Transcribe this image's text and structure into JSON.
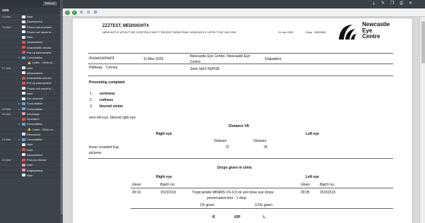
{
  "sidebar": {
    "refresh_label": "Refresh",
    "year": "2025",
    "events": [
      {
        "date": "11-Mar",
        "icon": "white",
        "label": "Note",
        "depth": 1
      },
      {
        "date": "",
        "icon": "doc",
        "label": "Assessment",
        "depth": 2
      },
      {
        "date": "10-Mar",
        "icon": "doc",
        "label": "Phone call received",
        "depth": 2
      },
      {
        "date": "",
        "icon": "doc",
        "label": "Phone call made to ...",
        "depth": 2
      },
      {
        "date": "",
        "icon": "doc",
        "label": "Note",
        "depth": 2
      },
      {
        "date": "",
        "icon": "red",
        "label": "Assessment",
        "depth": 2
      },
      {
        "date": "",
        "icon": "red",
        "label": "Anaesthetic checks",
        "depth": 2
      },
      {
        "date": "",
        "icon": "red",
        "label": "Pre-op assessment",
        "depth": 2
      },
      {
        "date": "",
        "icon": "blue",
        "label": "Consultation",
        "depth": 1,
        "twisty": "▾"
      },
      {
        "date": "",
        "icon": "yellow",
        "label": "Letter - Clinic ct...",
        "depth": 3
      },
      {
        "date": "07-Mar",
        "icon": "white",
        "label": "Note",
        "depth": 1
      },
      {
        "date": "",
        "icon": "doc",
        "label": "Assessment",
        "depth": 2
      },
      {
        "date": "",
        "icon": "red",
        "label": "Anaesthetic checks",
        "depth": 2
      },
      {
        "date": "",
        "icon": "red",
        "label": "Pre-op assessment",
        "depth": 2
      },
      {
        "date": "",
        "icon": "doc",
        "label": "Phone call made to ...",
        "depth": 2
      },
      {
        "date": "",
        "icon": "doc",
        "label": "Note",
        "depth": 2
      },
      {
        "date": "",
        "icon": "doc",
        "label": "Fax received",
        "depth": 2
      },
      {
        "date": "",
        "icon": "blue",
        "label": "Consultation",
        "depth": 1,
        "twisty": "▸"
      },
      {
        "date": "06-Mar",
        "icon": "blue",
        "label": "Consultation",
        "depth": 1,
        "twisty": "▸"
      },
      {
        "date": "25-Mar",
        "icon": "pink",
        "label": "Discharge",
        "depth": 1
      },
      {
        "date": "",
        "icon": "red",
        "label": "Operation",
        "depth": 2
      },
      {
        "date": "",
        "icon": "blue",
        "label": "Consultation",
        "depth": 1,
        "twisty": "▾"
      },
      {
        "date": "",
        "icon": "yellow",
        "label": "Letter - Clinic ou...",
        "depth": 3
      },
      {
        "date": "",
        "icon": "doc",
        "label": "Discussion",
        "depth": 2
      },
      {
        "date": "24-Mar",
        "icon": "blue",
        "label": "Consultation",
        "depth": 1,
        "twisty": "▸"
      },
      {
        "date": "",
        "icon": "doc",
        "label": "Note",
        "depth": 2
      },
      {
        "date": "",
        "icon": "red",
        "label": "Note",
        "depth": 2
      },
      {
        "date": "",
        "icon": "doc",
        "label": "Assessment",
        "depth": 2
      },
      {
        "date": "23-Mar",
        "icon": "red",
        "label": "Post-op checks",
        "depth": 2
      },
      {
        "date": "",
        "icon": "pink",
        "label": "Note",
        "depth": 2
      },
      {
        "date": "",
        "icon": "pink",
        "label": "Angiography",
        "depth": 2
      },
      {
        "date": "",
        "icon": "doc",
        "label": "Note",
        "depth": 2
      }
    ]
  },
  "topbar": {
    "icons": [
      "download-icon",
      "edit-icon",
      "copy-icon",
      "print-icon",
      "close-icon"
    ],
    "glyphs": [
      "⤓",
      "✎",
      "❐",
      "⎙",
      "✕"
    ]
  },
  "viewer_toolbar": {
    "nav": [
      {
        "name": "prev-page-button",
        "glyph": "‹"
      },
      {
        "name": "next-page-button",
        "glyph": "›"
      }
    ],
    "zoom": [
      {
        "name": "zoom-in-icon",
        "glyph": "⊕"
      },
      {
        "name": "zoom-out-icon",
        "glyph": "⊖"
      },
      {
        "name": "fit-page-icon",
        "glyph": "⊞"
      }
    ]
  },
  "document": {
    "patient_name": "ZZZTEST, MEDISIGHT4",
    "address": "NEWCASTLE UPON TYNE HOSPITALS NHS T, REGENT FARM ROAD, NEWCASTLE UPON TYNE, NE3 3HD",
    "dob": "01-Jan-1990",
    "hosp_label": "Hosp",
    "hosp_number": "91825992",
    "logo_text": [
      "Newcastle",
      "Eye",
      "Centre"
    ],
    "assessment": {
      "title": "Assessment",
      "date": "11-Mar-2025",
      "location_line1": "Newcastle Eye Centre, Newcastle Eye",
      "location_line2": "Centre",
      "type": "Outpatient",
      "pathway_label": "Pathway",
      "pathway": "Cornea",
      "seen_by_label": "Seen by",
      "seen_by": "01 NURSE"
    },
    "presenting_complaint": {
      "heading": "Presenting complaint",
      "items": [
        {
          "num": "1.",
          "text": "soreness"
        },
        {
          "num": "2.",
          "text": "redness"
        },
        {
          "num": "3.",
          "text": "blurred vision"
        }
      ],
      "note": "sore left eye, blurred right eye"
    },
    "distance_va": {
      "heading": "Distance VA",
      "right_eye": "Right eye",
      "left_eye": "Left eye",
      "col_glasses": "Glasses",
      "row_label_line1": "linear crowded Kay",
      "row_label_line2": "pictures",
      "right_value": "72",
      "left_value": "78"
    },
    "drops": {
      "heading": "Drops given in clinic",
      "right_eye": "Right eye",
      "left_eye": "Left eye",
      "col_given": "Given",
      "col_batch": "Batch no.",
      "right_time": "09:10",
      "right_batch": "15151515",
      "drug_line1": "Tropicamide MINIMS 1% 0.5 ml unit dose eye drops",
      "drug_line2": "preservative free - 1 drop",
      "left_time": "09:05",
      "left_batch": "15151515",
      "right_dose": "1% given",
      "left_dose": "0.5% given"
    },
    "iop": {
      "col_r": "R",
      "col_iop": "IOP",
      "col_l": "L"
    }
  }
}
